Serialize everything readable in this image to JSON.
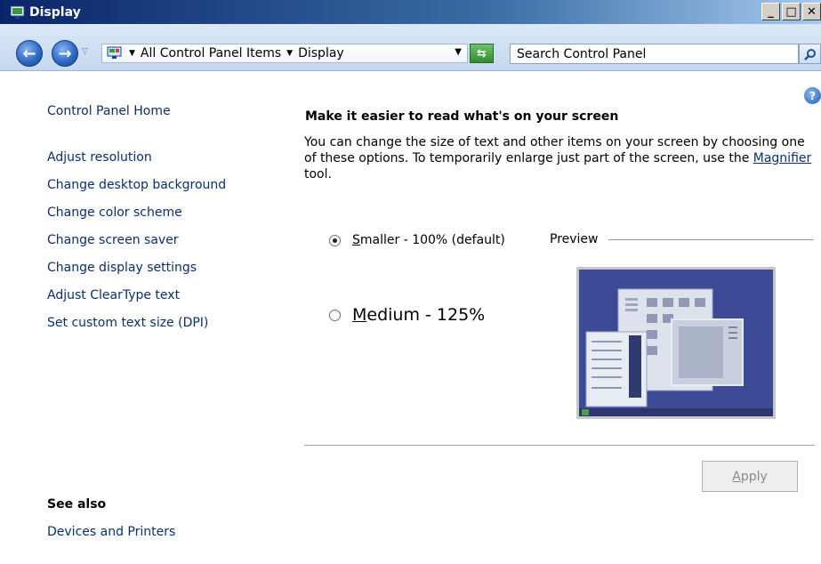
{
  "window": {
    "title": "Display",
    "minimize_label": "_",
    "maximize_label": "□",
    "close_label": "✕"
  },
  "navbar": {
    "back_icon": "back-arrow-icon",
    "forward_icon": "forward-arrow-icon",
    "breadcrumbs": [
      "All Control Panel Items",
      "Display"
    ],
    "search_placeholder": "Search Control Panel",
    "search_value": ""
  },
  "sidebar": {
    "home": "Control Panel Home",
    "tasks": [
      "Adjust resolution",
      "Change desktop background",
      "Change color scheme",
      "Change screen saver",
      "Change display settings",
      "Adjust ClearType text",
      "Set custom text size (DPI)"
    ],
    "see_also_heading": "See also",
    "see_also": [
      "Devices and Printers"
    ]
  },
  "main": {
    "heading": "Make it easier to read what's on your screen",
    "description_pre": "You can change the size of text and other items on your screen by choosing one of these options. To temporarily enlarge just part of the screen, use the ",
    "description_link": "Magnifier",
    "description_post": " tool.",
    "options": [
      {
        "accel": "S",
        "label_rest": "maller - 100% (default)",
        "selected": true
      },
      {
        "accel": "M",
        "label_rest": "edium - 125%",
        "selected": false
      }
    ],
    "preview_label": "Preview",
    "apply_accel": "A",
    "apply_rest": "pply",
    "apply_enabled": false
  },
  "colors": {
    "link": "#0b2f6c",
    "title_bar": "#0a246a",
    "preview_bg": "#3f4c98"
  }
}
